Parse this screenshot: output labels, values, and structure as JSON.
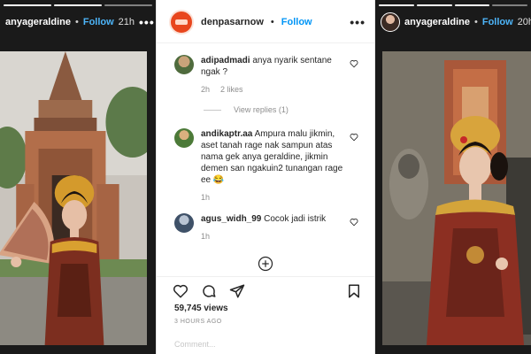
{
  "left_story": {
    "username": "anyageraldine",
    "dot": "•",
    "follow": "Follow",
    "time": "21h",
    "more": "•••"
  },
  "right_story": {
    "username": "anyageraldine",
    "dot": "•",
    "follow": "Follow",
    "time": "20h",
    "more": "•••"
  },
  "post": {
    "username": "denpasarnow",
    "dot": "•",
    "follow": "Follow",
    "more": "•••",
    "comments": [
      {
        "username": "adipadmadi",
        "text": "anya nyarik sentane ngak ?",
        "time": "2h",
        "likes": "2 likes"
      },
      {
        "username": "andikaptr.aa",
        "text": "Ampura malu jikmin, aset tanah rage nak sampun atas nama gek anya geraldine, jikmin demen san ngakuin2 tunangan rage ee 😂",
        "time": "1h"
      },
      {
        "username": "agus_widh_99",
        "text": "Cocok jadi istrik",
        "time": "1h"
      }
    ],
    "view_replies": "View replies (1)",
    "views": "59,745 views",
    "ago": "3 HOURS AGO",
    "add_comment": "Comment..."
  },
  "icons": {
    "heart": "heart-icon",
    "comment": "comment-icon",
    "share": "share-icon",
    "bookmark": "bookmark-icon",
    "add": "plus-circle-icon",
    "brand_color": "#e8461d",
    "follow_color": "#0095f6"
  }
}
